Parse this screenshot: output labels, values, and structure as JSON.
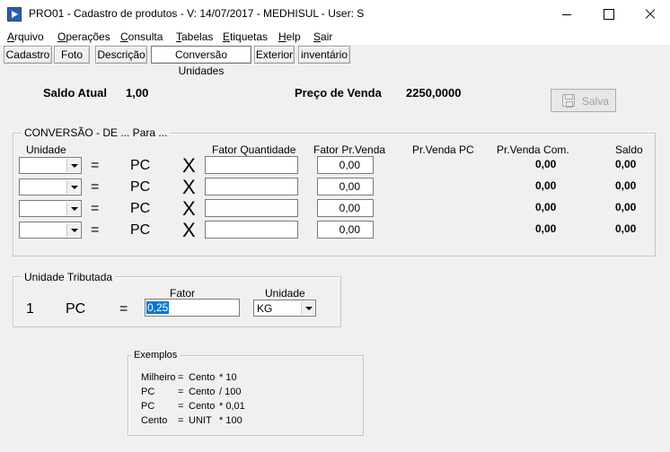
{
  "window": {
    "title": "PRO01 - Cadastro de produtos - V: 14/07/2017 - MEDHISUL - User: S"
  },
  "menu": [
    {
      "ul": "A",
      "rest": "rquivo"
    },
    {
      "ul": "O",
      "rest": "perações"
    },
    {
      "ul": "C",
      "rest": "onsulta"
    },
    {
      "ul": "T",
      "rest": "abelas"
    },
    {
      "ul": "E",
      "rest": "tiquetas"
    },
    {
      "ul": "H",
      "rest": "elp"
    },
    {
      "ul": "S",
      "rest": "air"
    }
  ],
  "tabs": [
    "Cadastro",
    "Foto",
    "Descrição",
    "Conversão Unidades",
    "Exterior",
    "inventário"
  ],
  "header": {
    "saldo_label": "Saldo Atual",
    "saldo_value": "1,00",
    "preco_label": "Preço de Venda",
    "preco_value": "2250,0000",
    "save_label": "Salva"
  },
  "conversion": {
    "title": "CONVERSÃO - DE ... Para ...",
    "col_unidade": "Unidade",
    "col_fator_qtd": "Fator Quantidade",
    "col_fator_prvenda": "Fator Pr.Venda",
    "col_prvenda_pc": "Pr.Venda PC",
    "col_prvenda_com": "Pr.Venda Com.",
    "col_saldo": "Saldo",
    "rows": [
      {
        "unit": "",
        "eq": "=",
        "base": "PC",
        "times": "X",
        "fator_qtd": "",
        "fator_prvenda": "0,00",
        "prvenda_com": "0,00",
        "saldo": "0,00"
      },
      {
        "unit": "",
        "eq": "=",
        "base": "PC",
        "times": "X",
        "fator_qtd": "",
        "fator_prvenda": "0,00",
        "prvenda_com": "0,00",
        "saldo": "0,00"
      },
      {
        "unit": "",
        "eq": "=",
        "base": "PC",
        "times": "X",
        "fator_qtd": "",
        "fator_prvenda": "0,00",
        "prvenda_com": "0,00",
        "saldo": "0,00"
      },
      {
        "unit": "",
        "eq": "=",
        "base": "PC",
        "times": "X",
        "fator_qtd": "",
        "fator_prvenda": "0,00",
        "prvenda_com": "0,00",
        "saldo": "0,00"
      }
    ]
  },
  "tributada": {
    "title": "Unidade Tributada",
    "qty": "1",
    "unit": "PC",
    "eq": "=",
    "fator_label": "Fator",
    "fator_value": "0,25",
    "unidade_label": "Unidade",
    "unidade_value": "KG"
  },
  "exemplos": {
    "title": "Exemplos",
    "lines": [
      {
        "a": "Milheiro",
        "eq": "=",
        "b": "Cento",
        "op": "* 10"
      },
      {
        "a": "PC",
        "eq": "=",
        "b": "Cento",
        "op": "/ 100"
      },
      {
        "a": "PC",
        "eq": "=",
        "b": "Cento",
        "op": "* 0,01"
      },
      {
        "a": "Cento",
        "eq": "=",
        "b": "UNIT",
        "op": "* 100"
      }
    ]
  }
}
